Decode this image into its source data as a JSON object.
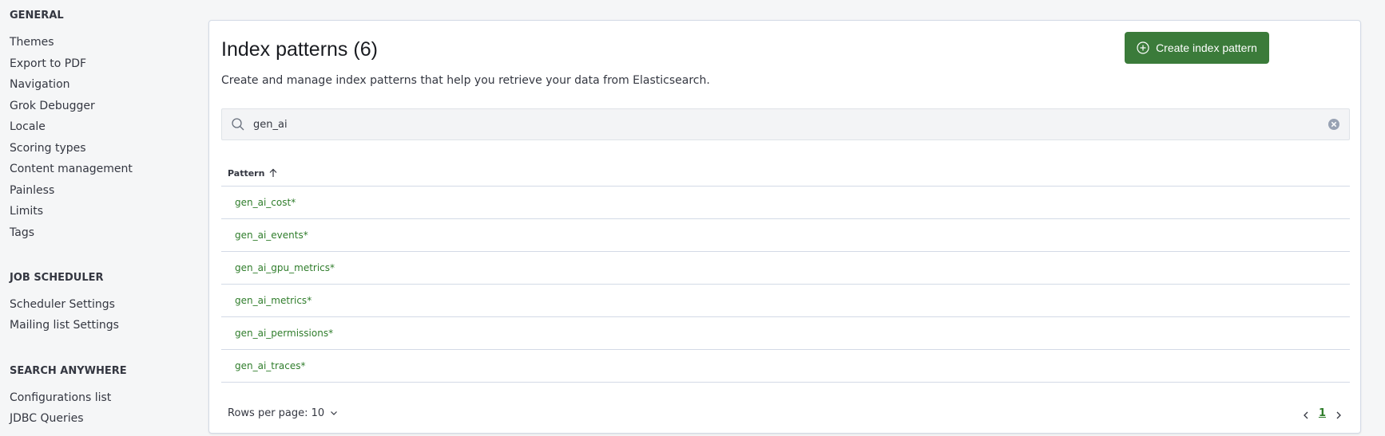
{
  "sidebar": {
    "general_title": "GENERAL",
    "general_items": [
      "Themes",
      "Export to PDF",
      "Navigation",
      "Grok Debugger",
      "Locale",
      "Scoring types",
      "Content management",
      "Painless",
      "Limits",
      "Tags"
    ],
    "job_title": "JOB SCHEDULER",
    "job_items": [
      "Scheduler Settings",
      "Mailing list Settings"
    ],
    "search_title": "SEARCH ANYWHERE",
    "search_items": [
      "Configurations list",
      "JDBC Queries"
    ]
  },
  "main": {
    "title": "Index patterns (6)",
    "description": "Create and manage index patterns that help you retrieve your data from Elasticsearch.",
    "create_button": "Create index pattern",
    "search_value": "gen_ai",
    "column_pattern": "Pattern",
    "rows": [
      "gen_ai_cost*",
      "gen_ai_events*",
      "gen_ai_gpu_metrics*",
      "gen_ai_metrics*",
      "gen_ai_permissions*",
      "gen_ai_traces*"
    ],
    "rows_per_page": "Rows per page: 10",
    "current_page": "1"
  },
  "colors": {
    "accent": "#3b7b3a",
    "link": "#2f7d2b"
  }
}
